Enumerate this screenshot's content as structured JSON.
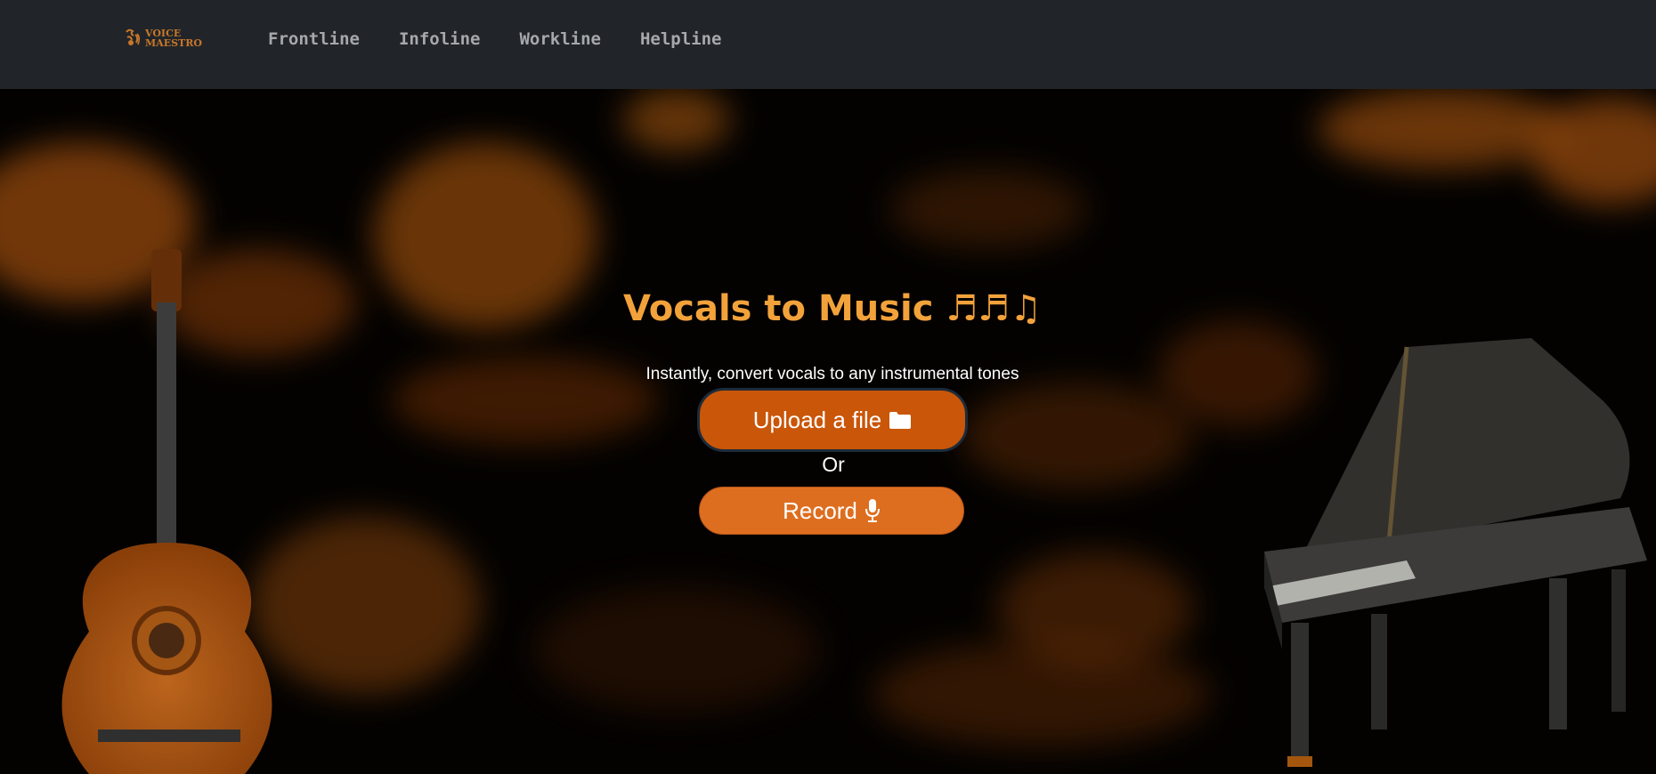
{
  "navbar": {
    "logo_line1": "VOICE",
    "logo_line2": "MAESTRO",
    "links": [
      "Frontline",
      "Infoline",
      "Workline",
      "Helpline"
    ]
  },
  "hero": {
    "title": "Vocals to Music",
    "title_icons": "♬♬♫",
    "subtitle": "Instantly, convert vocals to any instrumental tones",
    "upload_label": "Upload a file",
    "upload_icon": "folder-icon",
    "or_text": "Or",
    "record_label": "Record",
    "record_icon": "microphone-icon"
  },
  "colors": {
    "navbar_bg": "#212529",
    "accent": "#f2a23a",
    "upload_button": "#c95609",
    "record_button": "#de6e1f"
  }
}
